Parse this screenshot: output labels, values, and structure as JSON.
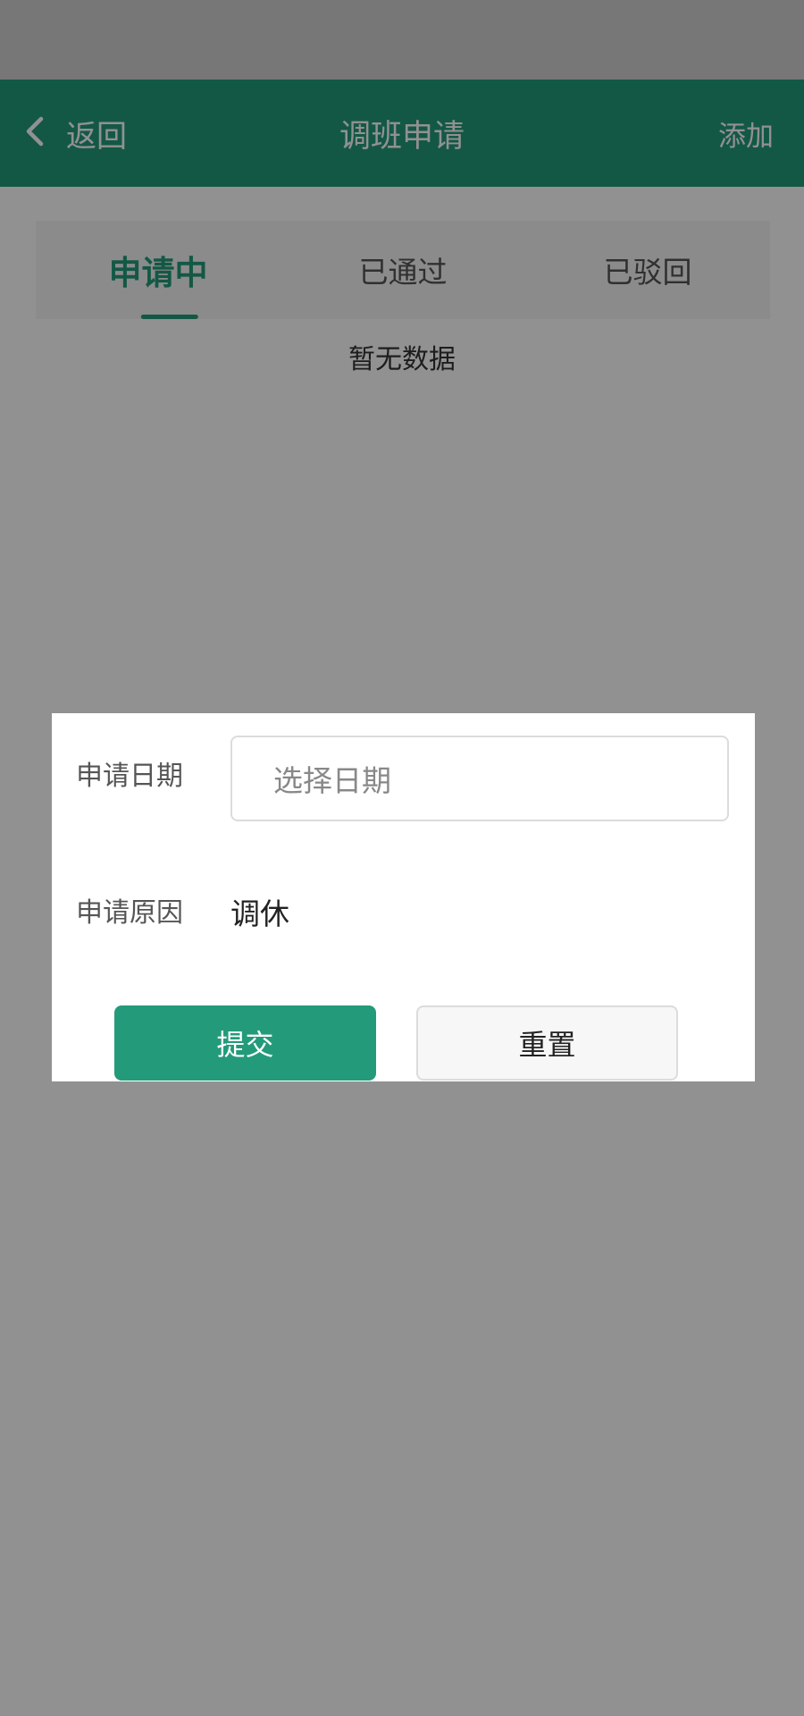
{
  "colors": {
    "brand": "#239b7a",
    "status_bar": "#d2d2d2",
    "overlay": "rgba(0,0,0,0.43)"
  },
  "nav": {
    "back_label": "返回",
    "back_icon": "chevron-left-icon",
    "title": "调班申请",
    "add_label": "添加"
  },
  "tabs": [
    {
      "label": "申请中",
      "active": true
    },
    {
      "label": "已通过",
      "active": false
    },
    {
      "label": "已驳回",
      "active": false
    }
  ],
  "empty_text": "暂无数据",
  "dialog": {
    "date_label": "申请日期",
    "date_placeholder": "选择日期",
    "reason_label": "申请原因",
    "reason_value": "调休",
    "submit_label": "提交",
    "reset_label": "重置"
  }
}
